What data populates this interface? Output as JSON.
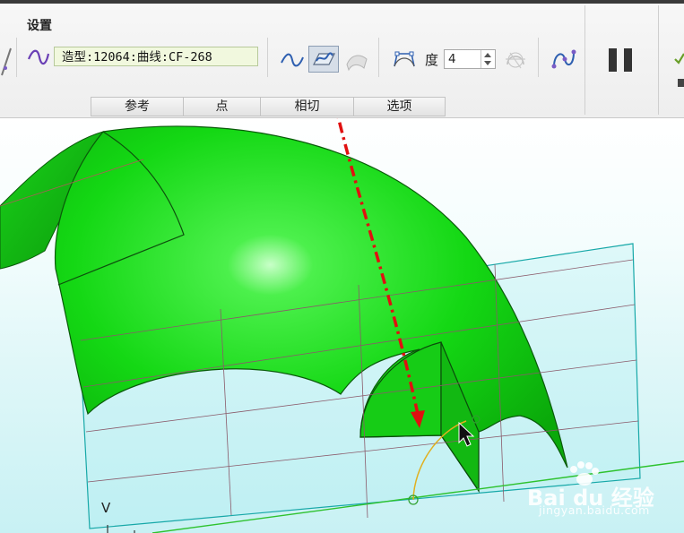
{
  "ribbon": {
    "group_title": "设置",
    "curve_field_value": "造型:12064:曲线:CF-268",
    "degree_label": "度",
    "degree_value": "4",
    "tabs": [
      "参考",
      "点",
      "相切",
      "选项"
    ],
    "icons": {
      "curve_type": "wave-curve-icon",
      "free_curve": "free-curve-icon",
      "plane_curve": "plane-curve-icon",
      "surface_curve": "surface-curve-icon",
      "control_polygon": "control-polygon-icon",
      "interpolation": "interpolation-icon",
      "pause": "pause-icon"
    }
  },
  "viewport": {
    "axis_label": "V"
  },
  "watermark": {
    "brand": "Bai du 经验",
    "url": "jingyan.baidu.com"
  },
  "colors": {
    "surface": "#14e014",
    "annotation_red": "#e01010",
    "plane_outline": "#17a8a8",
    "active_button": "#d6dee8"
  }
}
